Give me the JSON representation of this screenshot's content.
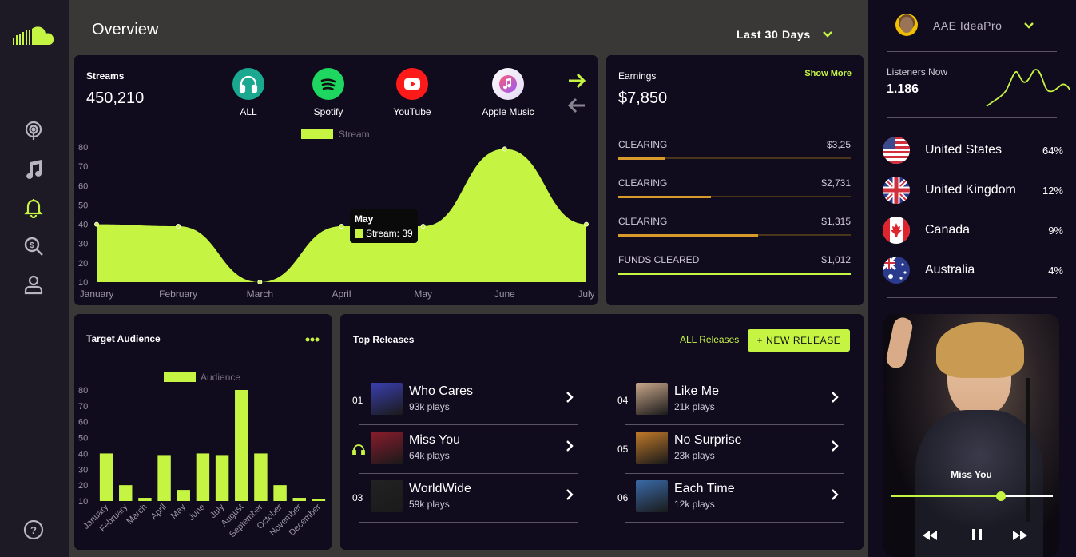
{
  "header": {
    "title": "Overview",
    "range_label": "Last 30 Days"
  },
  "streams": {
    "label": "Streams",
    "total": "450,210",
    "platforms": [
      {
        "label": "ALL",
        "icon": "headphones-icon",
        "color": "#1aa890"
      },
      {
        "label": "Spotify",
        "icon": "spotify-icon",
        "color": "#1ed760"
      },
      {
        "label": "YouTube",
        "icon": "youtube-icon",
        "color": "#ff0000"
      },
      {
        "label": "Apple Music",
        "icon": "apple-music-icon",
        "color": "#ffffff"
      }
    ],
    "tooltip": {
      "title": "May",
      "text": "Stream: 39"
    }
  },
  "earnings": {
    "label": "Earnings",
    "total": "$7,850",
    "show_more": "Show More",
    "rows": [
      {
        "label": "CLEARING",
        "amount": "$3,25",
        "progress": 0.2,
        "color": "#d89a2a"
      },
      {
        "label": "CLEARING",
        "amount": "$2,731",
        "progress": 0.4,
        "color": "#d89a2a"
      },
      {
        "label": "CLEARING",
        "amount": "$1,315",
        "progress": 0.6,
        "color": "#d89a2a"
      },
      {
        "label": "FUNDS CLEARED",
        "amount": "$1,012",
        "progress": 1.0,
        "color": "#c5f542"
      }
    ]
  },
  "target": {
    "label": "Target Audience",
    "more_icon": "ellipsis-icon"
  },
  "releases": {
    "label": "Top Releases",
    "all_link": "ALL Releases",
    "new_button": "+ NEW RELEASE",
    "items": [
      {
        "num": "01",
        "title": "Who Cares",
        "plays": "93k plays",
        "thumb": "#3a3fb0"
      },
      {
        "num": "",
        "title": "Miss You",
        "plays": "64k plays",
        "thumb": "#8a1c2c",
        "playing": true
      },
      {
        "num": "03",
        "title": "WorldWide",
        "plays": "59k plays",
        "thumb": "#222222"
      },
      {
        "num": "04",
        "title": "Like Me",
        "plays": "21k plays",
        "thumb": "#c9a78a"
      },
      {
        "num": "05",
        "title": "No Surprise",
        "plays": "23k plays",
        "thumb": "#c27a2a"
      },
      {
        "num": "06",
        "title": "Each Time",
        "plays": "12k plays",
        "thumb": "#3a6aa8"
      }
    ]
  },
  "profile": {
    "name": "AAE IdeaPro"
  },
  "listeners": {
    "label": "Listeners Now",
    "value": "1.186"
  },
  "countries": [
    {
      "name": "United States",
      "pct": "64%",
      "flag": "us-flag-icon"
    },
    {
      "name": "United Kingdom",
      "pct": "12%",
      "flag": "uk-flag-icon"
    },
    {
      "name": "Canada",
      "pct": "9%",
      "flag": "canada-flag-icon"
    },
    {
      "name": "Australia",
      "pct": "4%",
      "flag": "australia-flag-icon"
    }
  ],
  "player": {
    "track": "Miss You",
    "progress": 0.68
  },
  "chart_data": [
    {
      "type": "area",
      "series": [
        {
          "name": "Stream",
          "values": [
            40,
            39,
            10,
            39,
            39,
            79,
            40
          ]
        }
      ],
      "categories": [
        "January",
        "February",
        "March",
        "April",
        "May",
        "June",
        "July"
      ],
      "ylim": [
        10,
        80
      ],
      "yticks": [
        10,
        20,
        30,
        40,
        50,
        60,
        70,
        80
      ],
      "color": "#c5f542",
      "legend": "top-center"
    },
    {
      "type": "bar",
      "series": [
        {
          "name": "Audience",
          "values": [
            40,
            20,
            12,
            39,
            17,
            40,
            39,
            80,
            40,
            20,
            12,
            11
          ]
        }
      ],
      "categories": [
        "January",
        "February",
        "March",
        "April",
        "May",
        "June",
        "July",
        "August",
        "September",
        "October",
        "November",
        "December"
      ],
      "ylim": [
        10,
        80
      ],
      "yticks": [
        10,
        20,
        30,
        40,
        50,
        60,
        70,
        80
      ],
      "color": "#c5f542",
      "legend": "top-center"
    }
  ]
}
